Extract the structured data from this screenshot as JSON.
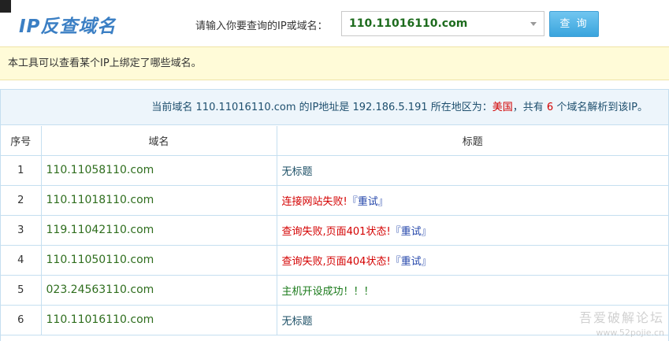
{
  "header": {
    "logo": "IP反查域名",
    "prompt": "请输入你要查询的IP或域名：",
    "input_value": "110.11016110.com",
    "query_button": "查 询"
  },
  "notice": "本工具可以查看某个IP上绑定了哪些域名。",
  "summary": {
    "prefix": "当前域名 ",
    "domain": "110.11016110.com",
    "ip_label": " 的IP地址是 ",
    "ip": "192.186.5.191",
    "region_label": " 所在地区为：",
    "region": "美国",
    "count_prefix": "，共有 ",
    "count": "6",
    "count_suffix": " 个域名解析到该IP。"
  },
  "table": {
    "headers": [
      "序号",
      "域名",
      "标题"
    ],
    "rows": [
      {
        "num": "1",
        "domain": "110.11058110.com",
        "title": "无标题",
        "retry": ""
      },
      {
        "num": "2",
        "domain": "110.11018110.com",
        "title": "连接网站失败!",
        "retry": "『重试』"
      },
      {
        "num": "3",
        "domain": "119.11042110.com",
        "title": "查询失败,页面401状态!",
        "retry": "『重试』"
      },
      {
        "num": "4",
        "domain": "110.11050110.com",
        "title": "查询失败,页面404状态!",
        "retry": "『重试』"
      },
      {
        "num": "5",
        "domain": "023.24563110.com",
        "title": "主机开设成功！！！",
        "retry": ""
      },
      {
        "num": "6",
        "domain": "110.11016110.com",
        "title": "无标题",
        "retry": ""
      }
    ]
  },
  "watermark": {
    "name": "吾爱破解论坛",
    "url": "www.52pojie.cn"
  },
  "colors": {
    "logo": "#3b7fc4",
    "domain_text": "#2f6e1e",
    "error_text": "#d40000",
    "success_text": "#1a7a1a",
    "retry_link": "#2244aa",
    "notice_bg": "#fffbd8",
    "summary_bg": "#edf5fb",
    "button": "#3aa4dd"
  }
}
